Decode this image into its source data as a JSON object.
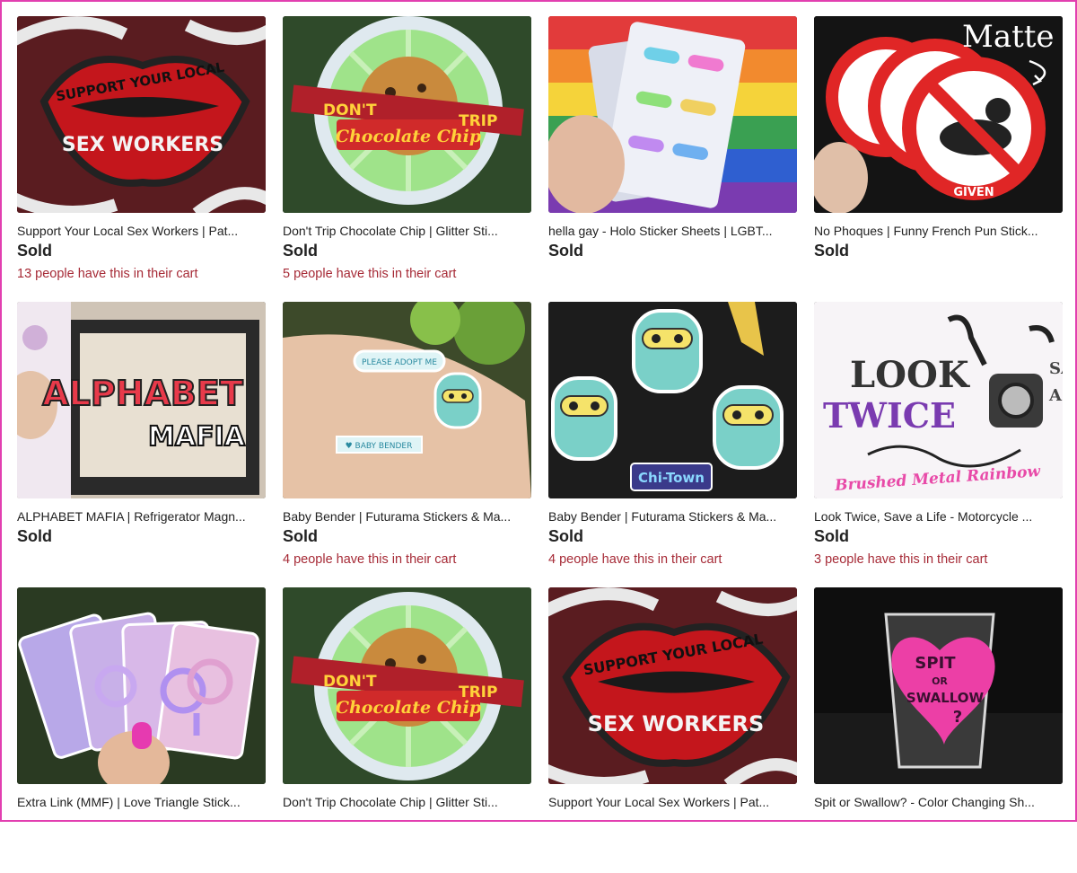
{
  "listings": [
    {
      "title": "Support Your Local Sex Workers | Pat...",
      "status": "Sold",
      "cart": "13 people have this in their cart",
      "image_text": {
        "arc": "SUPPORT YOUR LOCAL",
        "main": "SEX WORKERS"
      }
    },
    {
      "title": "Don't Trip Chocolate Chip | Glitter Sti...",
      "status": "Sold",
      "cart": "5 people have this in their cart",
      "image_text": {
        "banner_left": "DON'T",
        "banner_right": "TRIP",
        "script": "Chocolate Chip"
      }
    },
    {
      "title": "hella gay - Holo Sticker Sheets | LGBT...",
      "status": "Sold",
      "cart": ""
    },
    {
      "title": "No Phoques | Funny French Pun Stick...",
      "status": "Sold",
      "cart": "",
      "image_text": {
        "corner": "Matte",
        "top": "NO",
        "top2": "NO",
        "bottom": "GIVEN"
      }
    },
    {
      "title": "ALPHABET MAFIA | Refrigerator Magn...",
      "status": "Sold",
      "cart": "",
      "image_text": {
        "main": "ALPHABET",
        "sub": "MAFIA"
      }
    },
    {
      "title": "Baby Bender | Futurama Stickers & Ma...",
      "status": "Sold",
      "cart": "4 people have this in their cart",
      "image_text": {
        "bubble": "PLEASE ADOPT ME",
        "label": "♥ BABY BENDER"
      }
    },
    {
      "title": "Baby Bender | Futurama Stickers & Ma...",
      "status": "Sold",
      "cart": "4 people have this in their cart",
      "image_text": {
        "badge": "Chi-Town"
      }
    },
    {
      "title": "Look Twice, Save a Life - Motorcycle ...",
      "status": "Sold",
      "cart": "3 people have this in their cart",
      "image_text": {
        "line1": "LOOK",
        "line2": "TWICE",
        "tag": "Brushed Metal Rainbow",
        "edge1": "SA",
        "edge2": "A"
      }
    },
    {
      "title": "Extra Link (MMF) | Love Triangle Stick...",
      "status": "",
      "cart": ""
    },
    {
      "title": "Don't Trip Chocolate Chip | Glitter Sti...",
      "status": "",
      "cart": "",
      "image_text": {
        "banner_left": "DON'T",
        "banner_right": "TRIP",
        "script": "Chocolate Chip"
      }
    },
    {
      "title": "Support Your Local Sex Workers | Pat...",
      "status": "",
      "cart": "",
      "image_text": {
        "arc": "SUPPORT YOUR LOCAL",
        "main": "SEX WORKERS"
      }
    },
    {
      "title": "Spit or Swallow? - Color Changing Sh...",
      "status": "",
      "cart": "",
      "image_text": {
        "l1": "SPIT",
        "l2": "OR",
        "l3": "SWALLOW",
        "l4": "?"
      }
    }
  ],
  "colors": {
    "accent_frame": "#e23fb0",
    "cart_text": "#a62a36",
    "text": "#222222"
  }
}
